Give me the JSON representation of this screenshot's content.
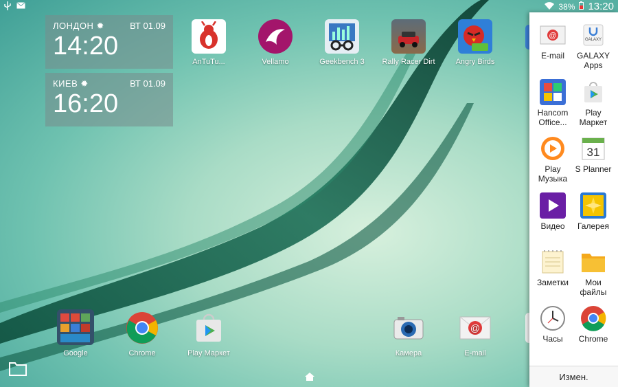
{
  "status_bar": {
    "usb_icon": "usb-icon",
    "mail_icon": "mail-icon",
    "wifi_icon": "wifi-icon",
    "battery": "38%",
    "time": "13:20"
  },
  "clocks": [
    {
      "city": "ЛОНДОН",
      "date": "ВТ 01.09",
      "time": "14:20"
    },
    {
      "city": "КИЕВ",
      "date": "ВТ 01.09",
      "time": "16:20"
    }
  ],
  "home_apps": [
    {
      "label": "AnTuTu...",
      "icon": "antutu-icon",
      "color": "#d8322b"
    },
    {
      "label": "Vellamo",
      "icon": "vellamo-icon",
      "color": "#a3156b"
    },
    {
      "label": "Geekbench 3",
      "icon": "geekbench-icon",
      "color": "#3a78c2"
    },
    {
      "label": "Rally Racer Dirt",
      "icon": "rally-icon",
      "color": "#6b4a32"
    },
    {
      "label": "Angry Birds",
      "icon": "angry-birds-icon",
      "color": "#2f7fd8"
    }
  ],
  "dock_apps": [
    {
      "label": "Google",
      "icon": "google-folder-icon"
    },
    {
      "label": "Chrome",
      "icon": "chrome-icon"
    },
    {
      "label": "Play Маркет",
      "icon": "play-store-icon"
    },
    {
      "label": "Камера",
      "icon": "camera-icon"
    },
    {
      "label": "E-mail",
      "icon": "email-icon"
    }
  ],
  "side_panel": {
    "apps": [
      {
        "label": "E-mail",
        "icon": "email-icon"
      },
      {
        "label": "GALAXY Apps",
        "icon": "galaxy-apps-icon"
      },
      {
        "label": "Hancom Office...",
        "icon": "hancom-office-icon"
      },
      {
        "label": "Play Маркет",
        "icon": "play-store-icon"
      },
      {
        "label": "Play Музыка",
        "icon": "play-music-icon"
      },
      {
        "label": "S Planner",
        "icon": "calendar-icon",
        "day": "31"
      },
      {
        "label": "Видео",
        "icon": "video-icon"
      },
      {
        "label": "Галерея",
        "icon": "gallery-icon"
      },
      {
        "label": "Заметки",
        "icon": "notes-icon"
      },
      {
        "label": "Мои файлы",
        "icon": "folder-icon"
      },
      {
        "label": "Часы",
        "icon": "clock-icon"
      },
      {
        "label": "Chrome",
        "icon": "chrome-icon"
      }
    ],
    "footer_button": "Измен."
  },
  "galaxy_icon_text": "GALAXY",
  "email_symbol": "@"
}
